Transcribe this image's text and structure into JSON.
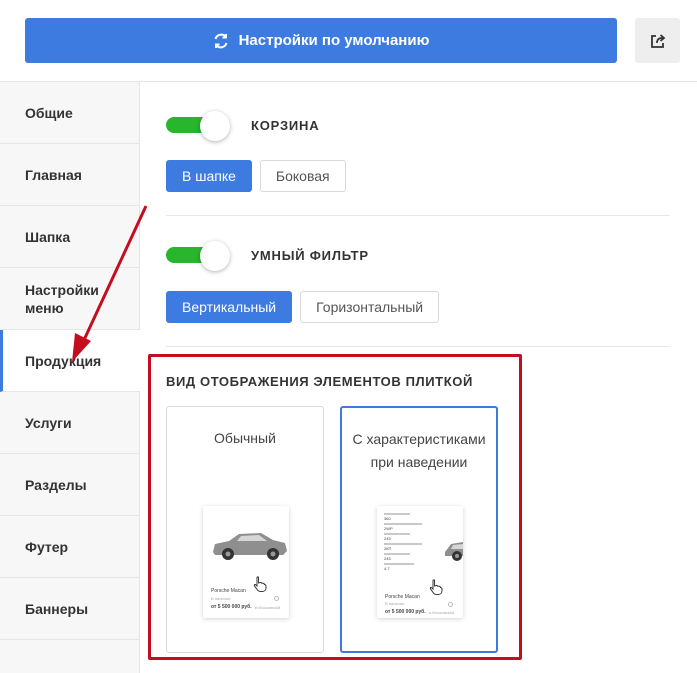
{
  "topbar": {
    "reset_label": "Настройки по умолчанию"
  },
  "sidebar": {
    "items": [
      {
        "label": "Общие"
      },
      {
        "label": "Главная"
      },
      {
        "label": "Шапка"
      },
      {
        "label": "Настройки меню"
      },
      {
        "label": "Продукция",
        "active": true
      },
      {
        "label": "Услуги"
      },
      {
        "label": "Разделы"
      },
      {
        "label": "Футер"
      },
      {
        "label": "Баннеры"
      }
    ]
  },
  "main": {
    "cart": {
      "label": "КОРЗИНА",
      "enabled": true,
      "options": [
        {
          "label": "В шапке",
          "active": true
        },
        {
          "label": "Боковая"
        }
      ]
    },
    "smart_filter": {
      "label": "УМНЫЙ ФИЛЬТР",
      "enabled": true,
      "options": [
        {
          "label": "Вертикальный",
          "active": true
        },
        {
          "label": "Горизонтальный"
        }
      ]
    },
    "tile_view": {
      "title": "ВИД ОТОБРАЖЕНИЯ ЭЛЕМЕНТОВ ПЛИТКОЙ",
      "cards": [
        {
          "title": "Обычный",
          "product_name": "Porsche Macan",
          "availability": "В наличии",
          "price": "от 5 500 000 руб.",
          "price_note": "в Московской"
        },
        {
          "title": "С характеристиками при наведении",
          "selected": true,
          "product_name": "Porsche Macan",
          "availability": "В наличии",
          "price": "от 5 500 000 руб.",
          "price_note": "в Московской",
          "specs": [
            "360",
            "2WP",
            "245",
            "2КП",
            "245",
            "4.7"
          ]
        }
      ]
    }
  },
  "colors": {
    "accent": "#3d7be0",
    "toggle_on": "#28b62c",
    "highlight": "#c40e20"
  }
}
